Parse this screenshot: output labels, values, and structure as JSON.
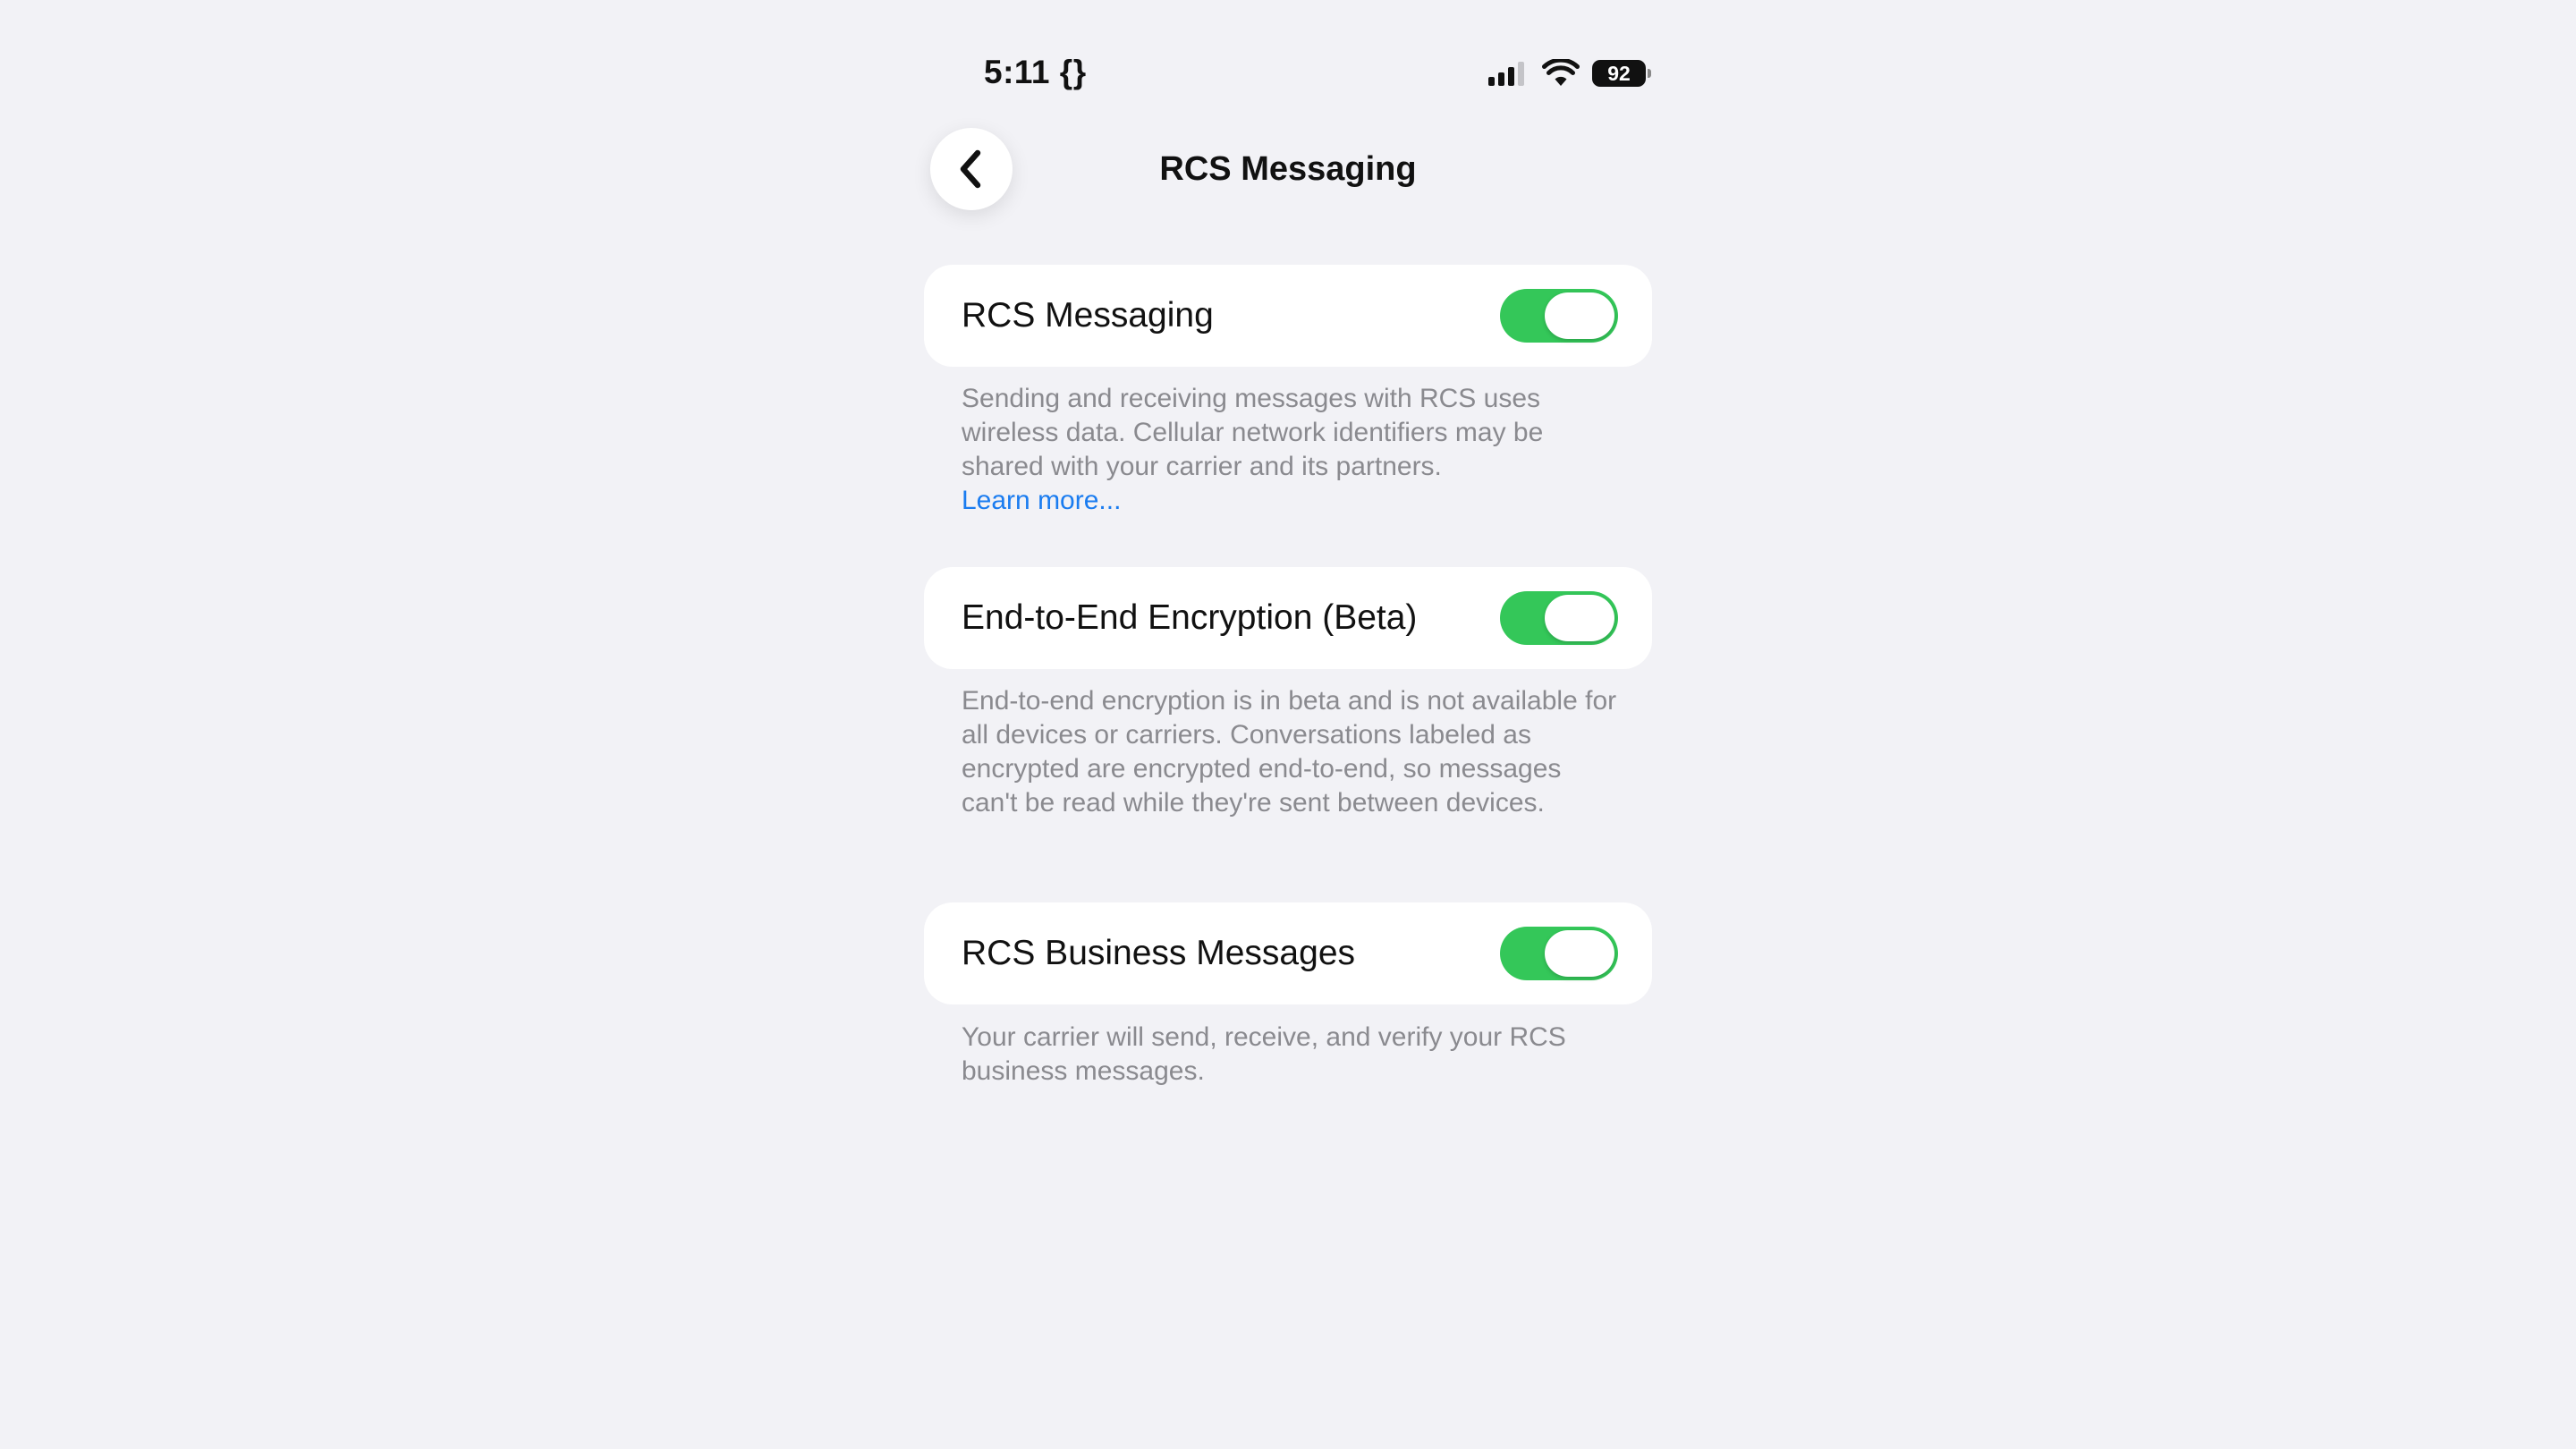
{
  "status_bar": {
    "time": "5:11",
    "time_icon": "curly-braces-icon",
    "time_icon_glyph": "{}",
    "signal_icon": "cellular-signal-icon",
    "wifi_icon": "wifi-icon",
    "battery_level": "92"
  },
  "nav": {
    "back_icon": "chevron-left-icon",
    "title": "RCS Messaging"
  },
  "settings": {
    "rcs_messaging": {
      "label": "RCS Messaging",
      "enabled": true,
      "footer": "Sending and receiving messages with RCS uses wireless data. Cellular network identifiers may be shared with your carrier and its partners.",
      "link": "Learn more..."
    },
    "e2e_encryption": {
      "label": "End-to-End Encryption (Beta)",
      "enabled": true,
      "footer": "End-to-end encryption is in beta and is not available for all devices or carriers. Conversations labeled as encrypted are encrypted end-to-end, so messages can't be read while they're sent between devices."
    },
    "business_messages": {
      "label": "RCS Business Messages",
      "enabled": true,
      "footer": "Your carrier will send, receive, and verify your RCS business messages."
    }
  },
  "colors": {
    "background": "#f2f2f6",
    "toggle_on": "#34c759",
    "link": "#1a7cf0",
    "footer_text": "#8a8a8f"
  }
}
